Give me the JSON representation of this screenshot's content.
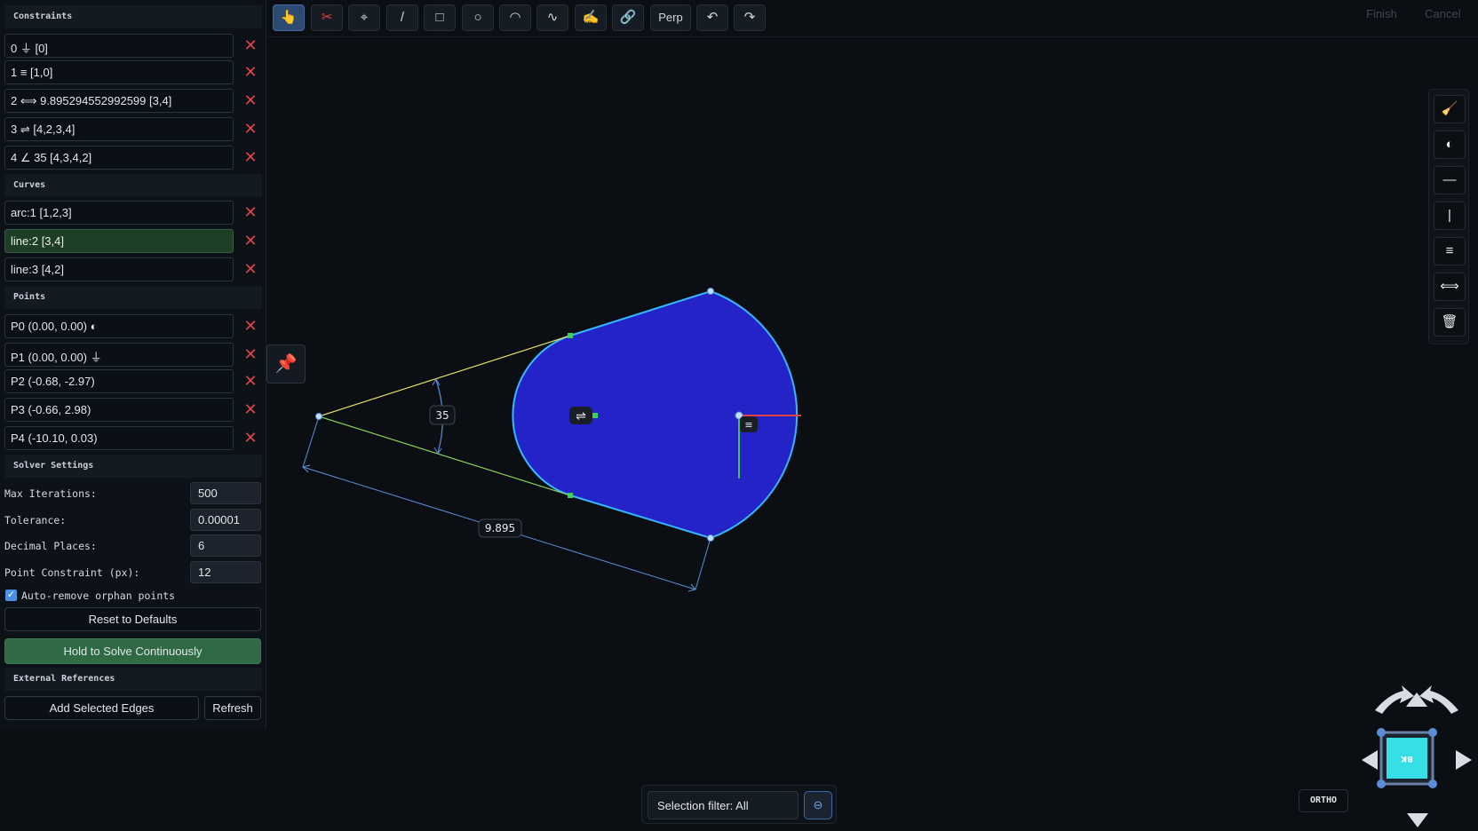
{
  "panel": {
    "constraints_header": "Constraints",
    "constraints": [
      {
        "label": "0 ⏚ [0]"
      },
      {
        "label": "1 ≡ [1,0]"
      },
      {
        "label": "2 ⟺ 9.895294552992599 [3,4]"
      },
      {
        "label": "3 ⇌ [4,2,3,4]"
      },
      {
        "label": "4 ∠ 35 [4,3,4,2]"
      }
    ],
    "curves_header": "Curves",
    "curves": [
      {
        "label": "arc:1 [1,2,3]",
        "selected": false
      },
      {
        "label": "line:2 [3,4]",
        "selected": true
      },
      {
        "label": "line:3 [4,2]",
        "selected": false
      }
    ],
    "points_header": "Points",
    "points": [
      {
        "label": "P0 (0.00, 0.00) ◐"
      },
      {
        "label": "P1 (0.00, 0.00) ⏚"
      },
      {
        "label": "P2 (-0.68, -2.97)"
      },
      {
        "label": "P3 (-0.66, 2.98)"
      },
      {
        "label": "P4 (-10.10, 0.03)"
      }
    ],
    "delete_icon": "close-icon",
    "solver_header": "Solver Settings",
    "solver": {
      "max_iterations_label": "Max Iterations:",
      "max_iterations": "500",
      "tolerance_label": "Tolerance:",
      "tolerance": "0.00001",
      "decimal_places_label": "Decimal Places:",
      "decimal_places": "6",
      "point_constraint_label": "Point Constraint (px):",
      "point_constraint": "12",
      "auto_remove_label": "Auto-remove orphan points",
      "auto_remove_checked": true
    },
    "reset_label": "Reset to Defaults",
    "solve_label": "Hold to Solve Continuously",
    "external_header": "External References",
    "add_edges_label": "Add Selected Edges",
    "refresh_label": "Refresh"
  },
  "toolbar": {
    "tools": [
      {
        "icon": "pointer-hand-icon",
        "glyph": "👆",
        "active": true
      },
      {
        "icon": "scissors-icon",
        "glyph": "✂",
        "active": false
      },
      {
        "icon": "point-icon",
        "glyph": "⌖",
        "active": false
      },
      {
        "icon": "line-icon",
        "glyph": "/",
        "active": false
      },
      {
        "icon": "rectangle-icon",
        "glyph": "□",
        "active": false
      },
      {
        "icon": "circle-icon",
        "glyph": "○",
        "active": false
      },
      {
        "icon": "arc-icon",
        "glyph": "◠",
        "active": false
      },
      {
        "icon": "spline-icon",
        "glyph": "∿",
        "active": false
      },
      {
        "icon": "hand-write-icon",
        "glyph": "✍",
        "active": false
      },
      {
        "icon": "link-icon",
        "glyph": "🔗",
        "active": false
      }
    ],
    "perp_label": "Perp",
    "undo_glyph": "↶",
    "redo_glyph": "↷",
    "finish_label": "Finish",
    "cancel_label": "Cancel"
  },
  "canvas": {
    "angle_label": "35",
    "distance_label": "9.895",
    "colors": {
      "fill": "#2323c8",
      "outline": "#36b6ff",
      "yellow_line": "#e6df6a",
      "green_line": "#8ad05a",
      "dimension": "#5a8fd8",
      "axis_x": "#e0424a",
      "axis_y": "#3ec25a"
    }
  },
  "right_bar": [
    {
      "icon": "broom-icon",
      "glyph": "🧹"
    },
    {
      "icon": "half-circle-icon",
      "glyph": "◐"
    },
    {
      "icon": "horizontal-icon",
      "glyph": "—"
    },
    {
      "icon": "vertical-icon",
      "glyph": "|"
    },
    {
      "icon": "coincident-icon",
      "glyph": "≡"
    },
    {
      "icon": "distance-icon",
      "glyph": "⟺"
    },
    {
      "icon": "trash-icon",
      "glyph": "🗑"
    }
  ],
  "pin_glyph": "📌",
  "selection_filter": {
    "label": "Selection filter: All",
    "button_glyph": "⊖"
  },
  "view": {
    "ortho_label": "ORTHO",
    "cube_face_label": "BK"
  }
}
